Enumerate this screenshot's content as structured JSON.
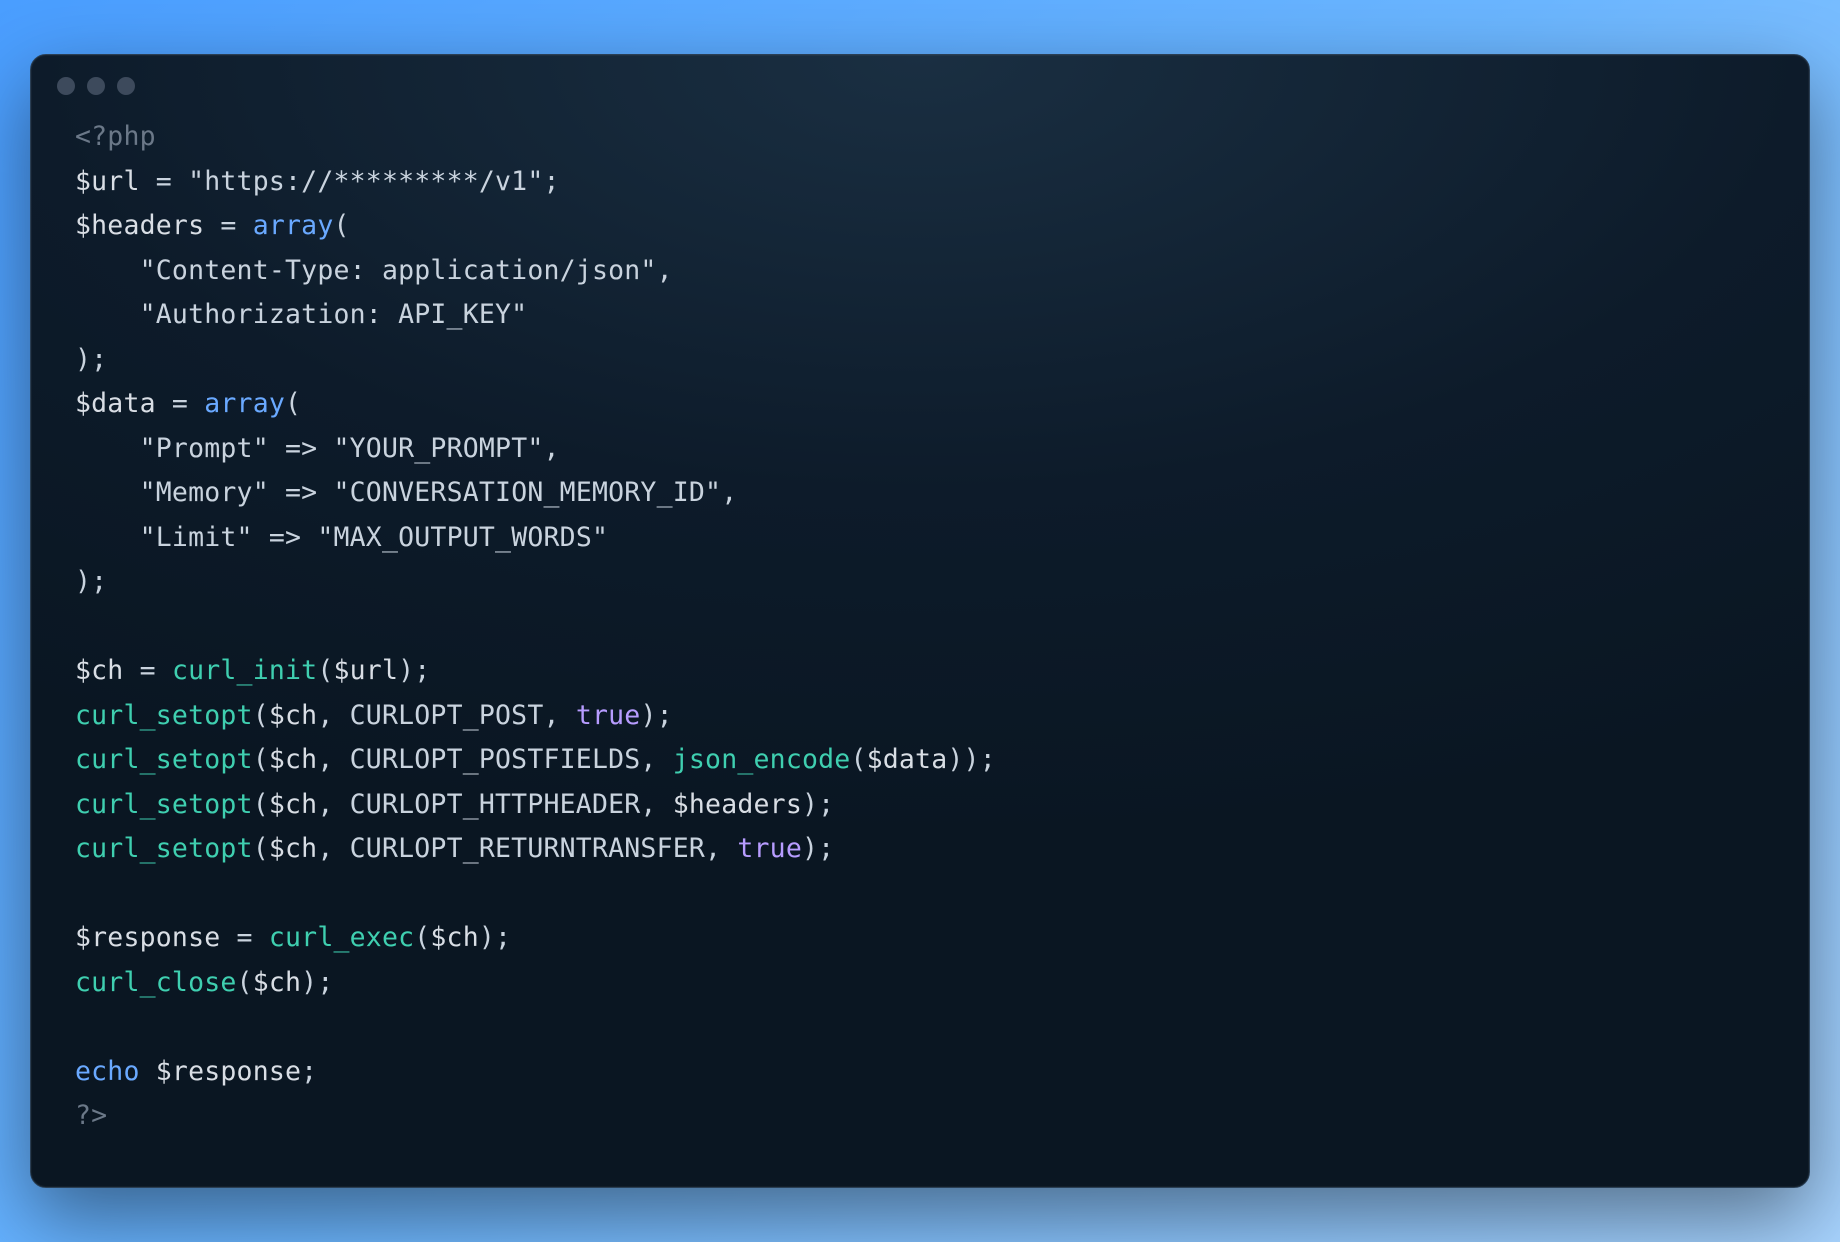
{
  "code": {
    "php_open": "<?php",
    "php_close": "?>",
    "url_var": "$url",
    "url_assign": " = ",
    "url_value": "\"https://*********/v1\"",
    "semicolon": ";",
    "headers_var": "$headers",
    "array_kw": "array",
    "lparen": "(",
    "rparen": ")",
    "header_ct": "\"Content-Type: application/json\"",
    "comma": ",",
    "header_auth": "\"Authorization: API_KEY\"",
    "data_var": "$data",
    "prompt_key": "\"Prompt\"",
    "arrow": " => ",
    "prompt_val": "\"YOUR_PROMPT\"",
    "memory_key": "\"Memory\"",
    "memory_val": "\"CONVERSATION_MEMORY_ID\"",
    "limit_key": "\"Limit\"",
    "limit_val": "\"MAX_OUTPUT_WORDS\"",
    "ch_var": "$ch",
    "curl_init": "curl_init",
    "curl_setopt": "curl_setopt",
    "curlopt_post": "CURLOPT_POST",
    "true_kw": "true",
    "curlopt_postfields": "CURLOPT_POSTFIELDS",
    "json_encode": "json_encode",
    "curlopt_httpheader": "CURLOPT_HTTPHEADER",
    "curlopt_returntransfer": "CURLOPT_RETURNTRANSFER",
    "response_var": "$response",
    "curl_exec": "curl_exec",
    "curl_close": "curl_close",
    "echo_kw": "echo",
    "indent": "    ",
    "comma_sp": ", "
  }
}
